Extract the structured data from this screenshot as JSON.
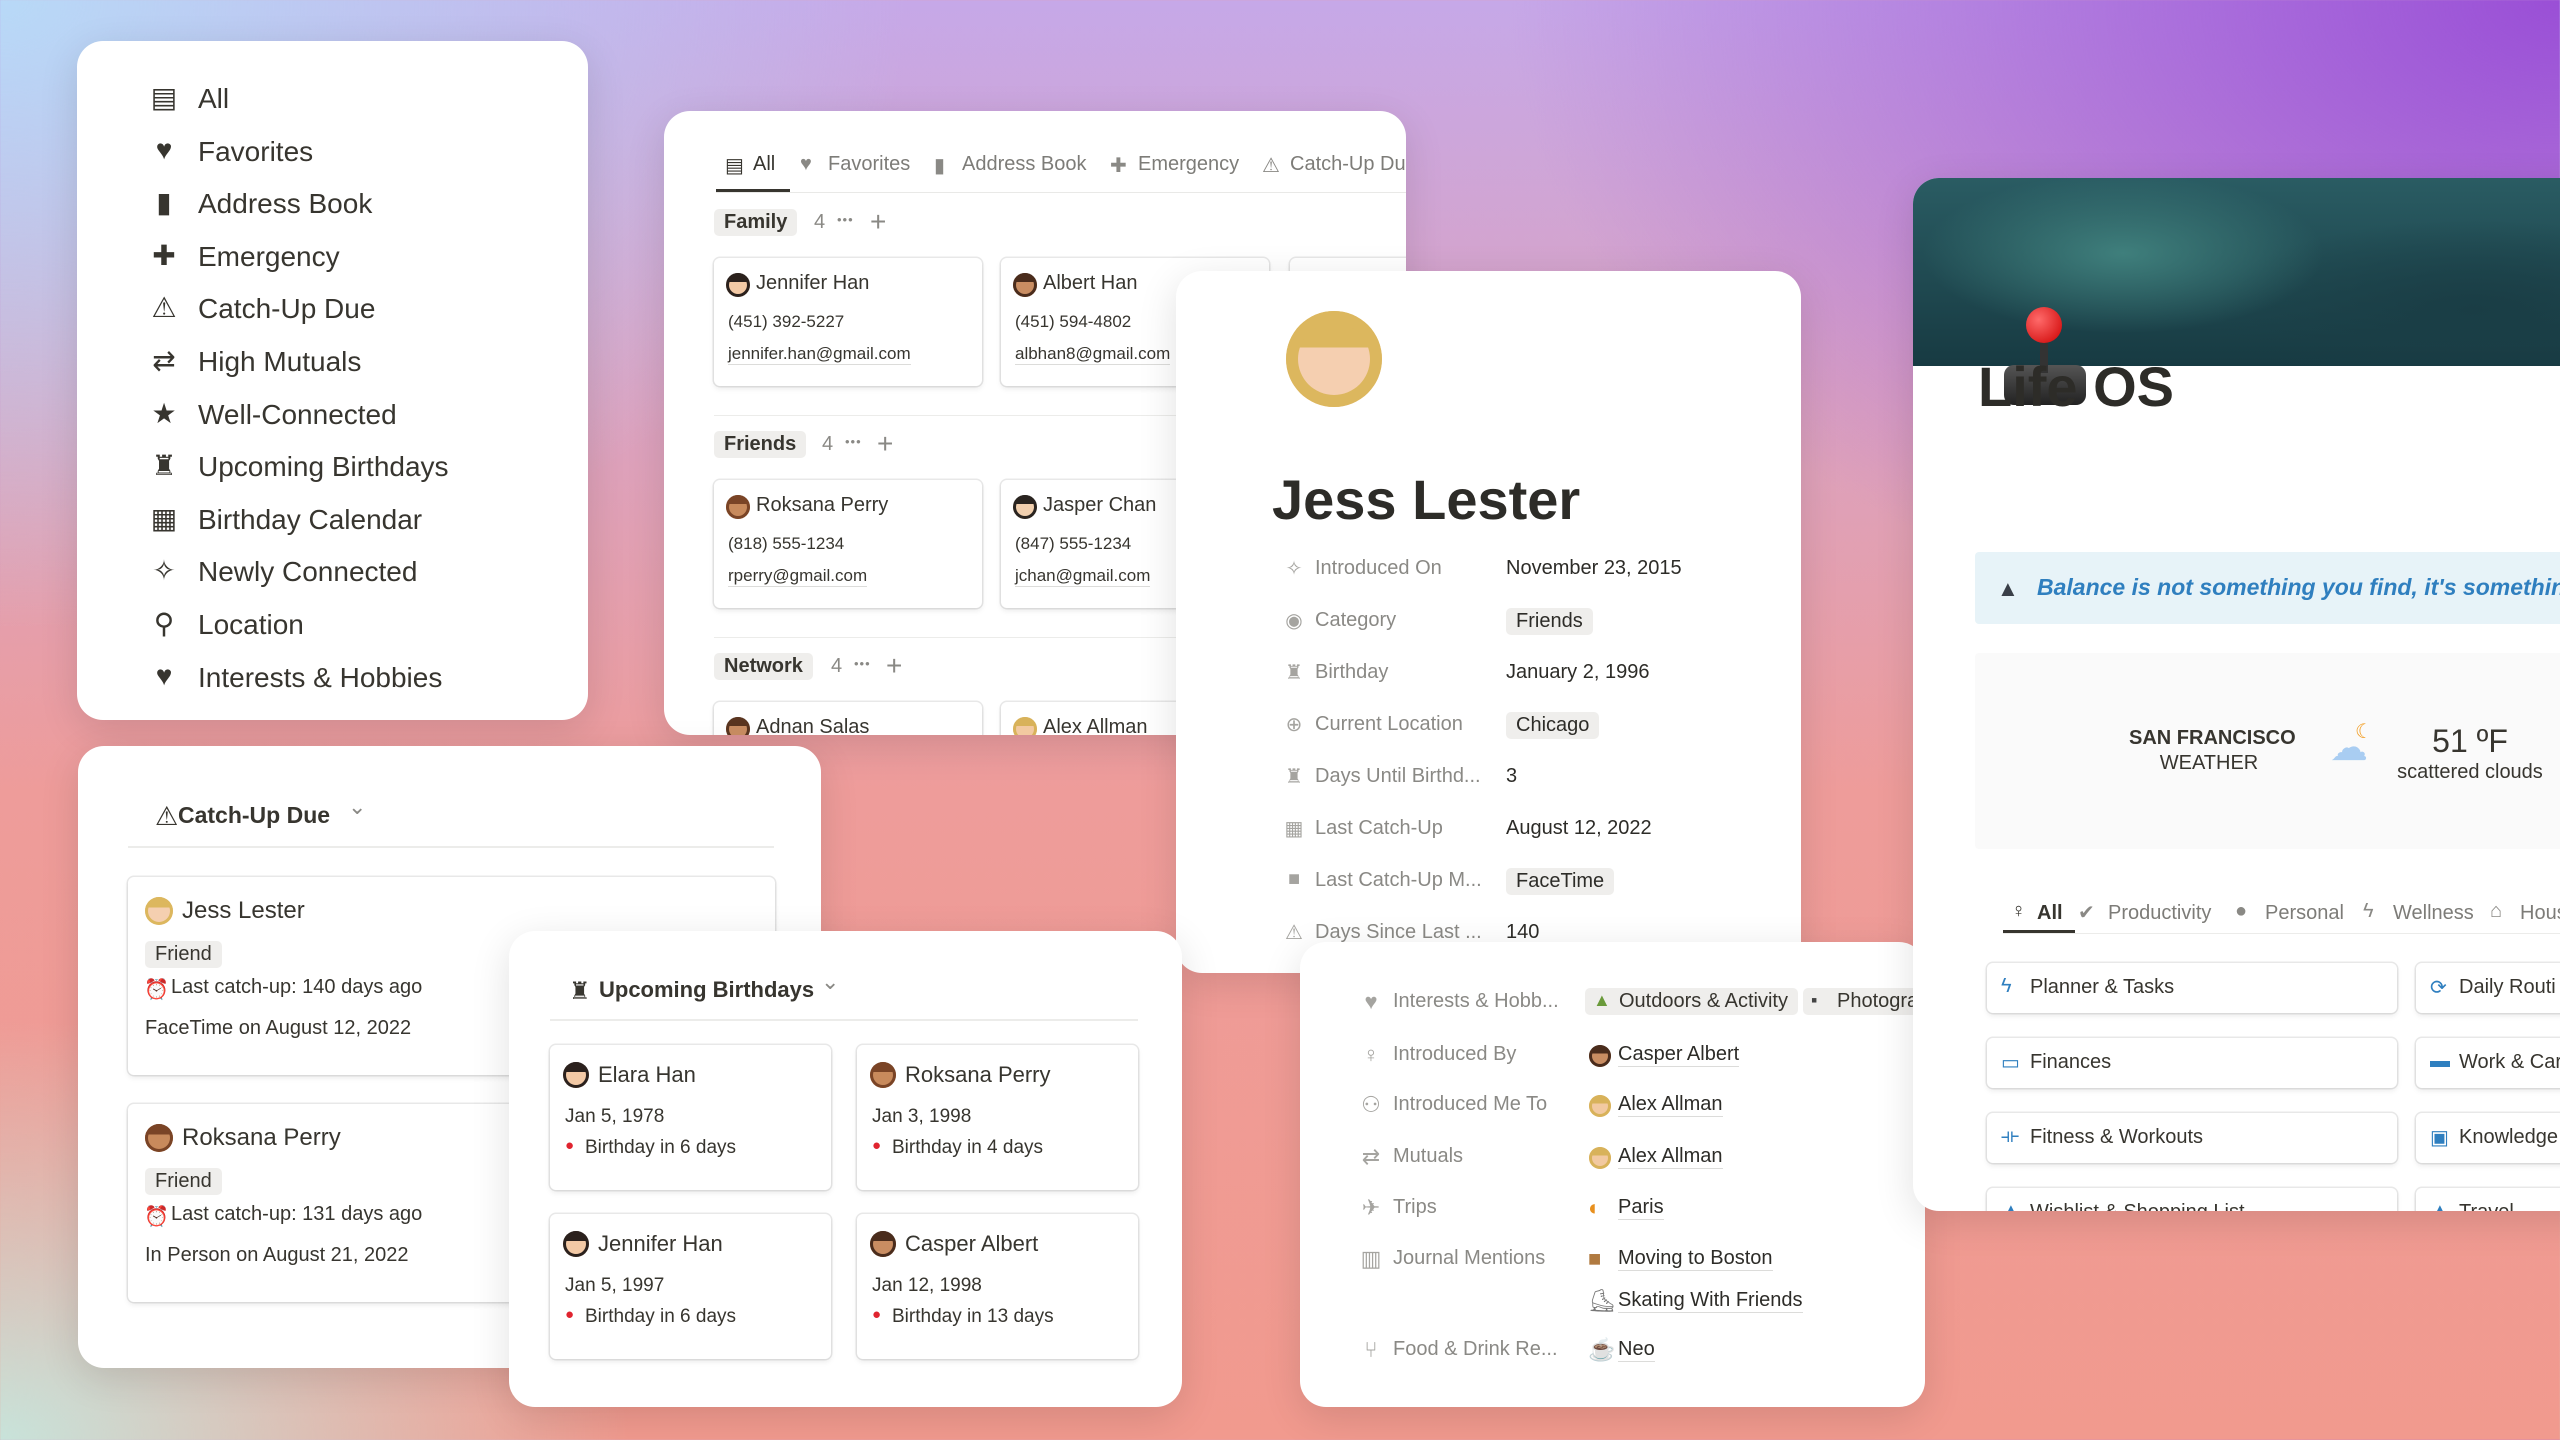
{
  "colors": {
    "accent_blue": "#2f7fbf",
    "text": "#37352f",
    "muted": "#8a8985",
    "tag_bg": "#efeeec"
  },
  "sidebar": {
    "items": [
      {
        "icon": "contact-card-icon",
        "label": "All"
      },
      {
        "icon": "heart-icon",
        "label": "Favorites"
      },
      {
        "icon": "book-icon",
        "label": "Address Book"
      },
      {
        "icon": "plus-icon",
        "label": "Emergency"
      },
      {
        "icon": "warning-icon",
        "label": "Catch-Up Due"
      },
      {
        "icon": "arrows-icon",
        "label": "High Mutuals"
      },
      {
        "icon": "star-icon",
        "label": "Well-Connected"
      },
      {
        "icon": "cake-icon",
        "label": "Upcoming Birthdays"
      },
      {
        "icon": "calendar-icon",
        "label": "Birthday Calendar"
      },
      {
        "icon": "sparkles-icon",
        "label": "Newly Connected"
      },
      {
        "icon": "pin-icon",
        "label": "Location"
      },
      {
        "icon": "heart-icon",
        "label": "Interests & Hobbies"
      }
    ]
  },
  "address_book": {
    "tabs": [
      {
        "icon": "contact-card-icon",
        "label": "All",
        "active": true
      },
      {
        "icon": "heart-icon",
        "label": "Favorites"
      },
      {
        "icon": "book-icon",
        "label": "Address Book"
      },
      {
        "icon": "plus-icon",
        "label": "Emergency"
      },
      {
        "icon": "warning-icon",
        "label": "Catch-Up Du"
      }
    ],
    "groups": [
      {
        "name": "Family",
        "count": "4",
        "cards": [
          {
            "avatar": "woman-dark",
            "name": "Jennifer Han",
            "phone": "(451) 392-5227",
            "email": "jennifer.han@gmail.com"
          },
          {
            "avatar": "man-beard",
            "name": "Albert Han",
            "phone": "(451) 594-4802",
            "email": "albhan8@gmail.com"
          }
        ]
      },
      {
        "name": "Friends",
        "count": "4",
        "cards": [
          {
            "avatar": "woman-brown",
            "name": "Roksana Perry",
            "phone": "(818) 555-1234",
            "email": "rperry@gmail.com"
          },
          {
            "avatar": "man-mustache",
            "name": "Jasper Chan",
            "phone": "(847) 555-1234",
            "email": "jchan@gmail.com"
          }
        ]
      },
      {
        "name": "Network",
        "count": "4",
        "cards": [
          {
            "avatar": "man-brown",
            "name": "Adnan Salas"
          },
          {
            "avatar": "man-blond",
            "name": "Alex Allman"
          }
        ]
      }
    ]
  },
  "contact": {
    "avatar": "woman-blond",
    "name": "Jess Lester",
    "properties": [
      {
        "icon": "sparkles-icon",
        "label": "Introduced On",
        "value": "November 23, 2015"
      },
      {
        "icon": "category-icon",
        "label": "Category",
        "value": "Friends",
        "tag": true
      },
      {
        "icon": "cake-icon",
        "label": "Birthday",
        "value": "January 2, 1996"
      },
      {
        "icon": "globe-icon",
        "label": "Current Location",
        "value": "Chicago",
        "tag": true
      },
      {
        "icon": "cake-icon",
        "label": "Days Until Birthd...",
        "value": "3"
      },
      {
        "icon": "calendar-icon",
        "label": "Last Catch-Up",
        "value": "August 12, 2022"
      },
      {
        "icon": "video-icon",
        "label": "Last Catch-Up M...",
        "value": "FaceTime",
        "tag": true
      },
      {
        "icon": "warning-icon",
        "label": "Days Since Last ...",
        "value": "140"
      }
    ]
  },
  "relations": {
    "rows": [
      {
        "icon": "heart-icon",
        "label": "Interests & Hobb...",
        "tags": [
          {
            "icon": "mountain",
            "text": "Outdoors & Activity"
          },
          {
            "icon": "camera",
            "text": "Photogra"
          }
        ]
      },
      {
        "icon": "person-icon",
        "label": "Introduced By",
        "links": [
          {
            "icon": "man-beard",
            "text": "Casper Albert"
          }
        ]
      },
      {
        "icon": "add-person-icon",
        "label": "Introduced Me To",
        "links": [
          {
            "icon": "man-blond",
            "text": "Alex Allman"
          }
        ]
      },
      {
        "icon": "arrows-icon",
        "label": "Mutuals",
        "links": [
          {
            "icon": "man-blond",
            "text": "Alex Allman"
          }
        ]
      },
      {
        "icon": "airplane-icon",
        "label": "Trips",
        "links": [
          {
            "icon": "croissant",
            "text": "Paris"
          }
        ]
      },
      {
        "icon": "book-open-icon",
        "label": "Journal Mentions",
        "links": [
          {
            "icon": "package",
            "text": "Moving to Boston"
          },
          {
            "icon": "skate",
            "text": "Skating With Friends"
          }
        ]
      },
      {
        "icon": "fork-knife-icon",
        "label": "Food & Drink Re...",
        "links": [
          {
            "icon": "coffee",
            "text": "Neo"
          }
        ]
      }
    ]
  },
  "catchup": {
    "title": "Catch-Up Due",
    "cards": [
      {
        "avatar": "woman-blond",
        "name": "Jess Lester",
        "tag": "Friend",
        "last": "Last catch-up: 140 days ago",
        "method": "FaceTime on August 12, 2022"
      },
      {
        "avatar": "woman-brown",
        "name": "Roksana Perry",
        "tag": "Friend",
        "last": "Last catch-up: 131 days ago",
        "method": "In Person on August 21, 2022"
      }
    ]
  },
  "birthdays": {
    "title": "Upcoming Birthdays",
    "cards": [
      {
        "avatar": "woman-dark",
        "name": "Elara Han",
        "date": "Jan 5, 1978",
        "in": "Birthday in 6 days"
      },
      {
        "avatar": "woman-brown",
        "name": "Roksana Perry",
        "date": "Jan 3, 1998",
        "in": "Birthday in 4 days"
      },
      {
        "avatar": "woman-dark",
        "name": "Jennifer Han",
        "date": "Jan 5, 1997",
        "in": "Birthday in 6 days"
      },
      {
        "avatar": "man-beard",
        "name": "Casper Albert",
        "date": "Jan 12, 1998",
        "in": "Birthday in 13 days"
      }
    ]
  },
  "lifeos": {
    "title": "Life OS",
    "quote": "Balance is not something you find, it's something y",
    "weather": {
      "city": "SAN FRANCISCO",
      "label": "WEATHER",
      "temp": "51 ºF",
      "desc": "scattered clouds",
      "icon": "partly-cloudy-night-icon"
    },
    "tabs": [
      {
        "icon": "person-icon",
        "label": "All",
        "active": true
      },
      {
        "icon": "check-circle-icon",
        "label": "Productivity"
      },
      {
        "icon": "user-icon",
        "label": "Personal"
      },
      {
        "icon": "bolt-icon",
        "label": "Wellness"
      },
      {
        "icon": "house-icon",
        "label": "Hous"
      }
    ],
    "links": [
      {
        "icon": "bolt-icon",
        "label": "Planner & Tasks"
      },
      {
        "icon": "refresh-icon",
        "label": "Daily Routi"
      },
      {
        "icon": "money-icon",
        "label": "Finances"
      },
      {
        "icon": "briefcase-icon",
        "label": "Work & Car"
      },
      {
        "icon": "dumbbell-icon",
        "label": "Fitness & Workouts"
      },
      {
        "icon": "browser-icon",
        "label": "Knowledge"
      },
      {
        "icon": "bag-icon",
        "label": "Wishlist & Shopping List"
      },
      {
        "icon": "bag-icon",
        "label": "Travel"
      }
    ]
  }
}
